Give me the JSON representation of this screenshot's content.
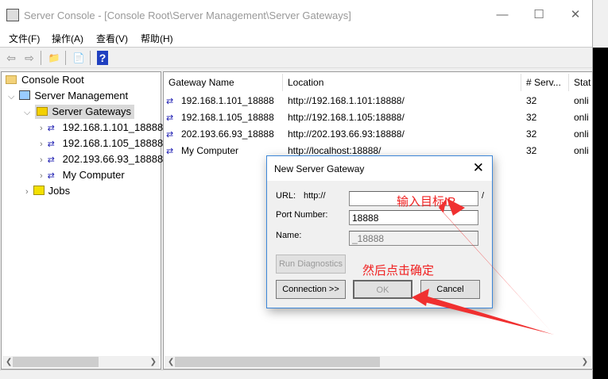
{
  "window": {
    "title": "Server Console - [Console Root\\Server Management\\Server Gateways]",
    "minimize": "—",
    "maximize": "☐",
    "close": "✕"
  },
  "menu": [
    "文件(F)",
    "操作(A)",
    "查看(V)",
    "帮助(H)"
  ],
  "toolbar": {
    "back": "⇦",
    "forward": "⇨",
    "up": "📁",
    "export": "📄",
    "help": "?"
  },
  "tree": {
    "root": "Console Root",
    "management": "Server Management",
    "gateways": "Server Gateways",
    "children": [
      "192.168.1.101_18888",
      "192.168.1.105_18888",
      "202.193.66.93_18888",
      "My Computer"
    ],
    "jobs": "Jobs"
  },
  "list": {
    "columns": [
      "Gateway Name",
      "Location",
      "# Serv...",
      "Stat"
    ],
    "rows": [
      [
        "192.168.1.101_18888",
        "http://192.168.1.101:18888/",
        "32",
        "onli"
      ],
      [
        "192.168.1.105_18888",
        "http://192.168.1.105:18888/",
        "32",
        "onli"
      ],
      [
        "202.193.66.93_18888",
        "http://202.193.66.93:18888/",
        "32",
        "onli"
      ],
      [
        "My Computer",
        "http://localhost:18888/",
        "32",
        "onli"
      ]
    ]
  },
  "dialog": {
    "title": "New Server Gateway",
    "url_label": "URL:",
    "url_prefix": "http://",
    "url_value": "",
    "url_suffix": "/",
    "port_label": "Port Number:",
    "port_value": "18888",
    "name_label": "Name:",
    "name_value": "_18888",
    "run_diag": "Run Diagnostics",
    "connection": "Connection >>",
    "ok": "OK",
    "cancel": "Cancel"
  },
  "annotations": {
    "enter_ip": "输入目标IP",
    "then_ok": "然后点击确定",
    "color": "#f02020"
  }
}
